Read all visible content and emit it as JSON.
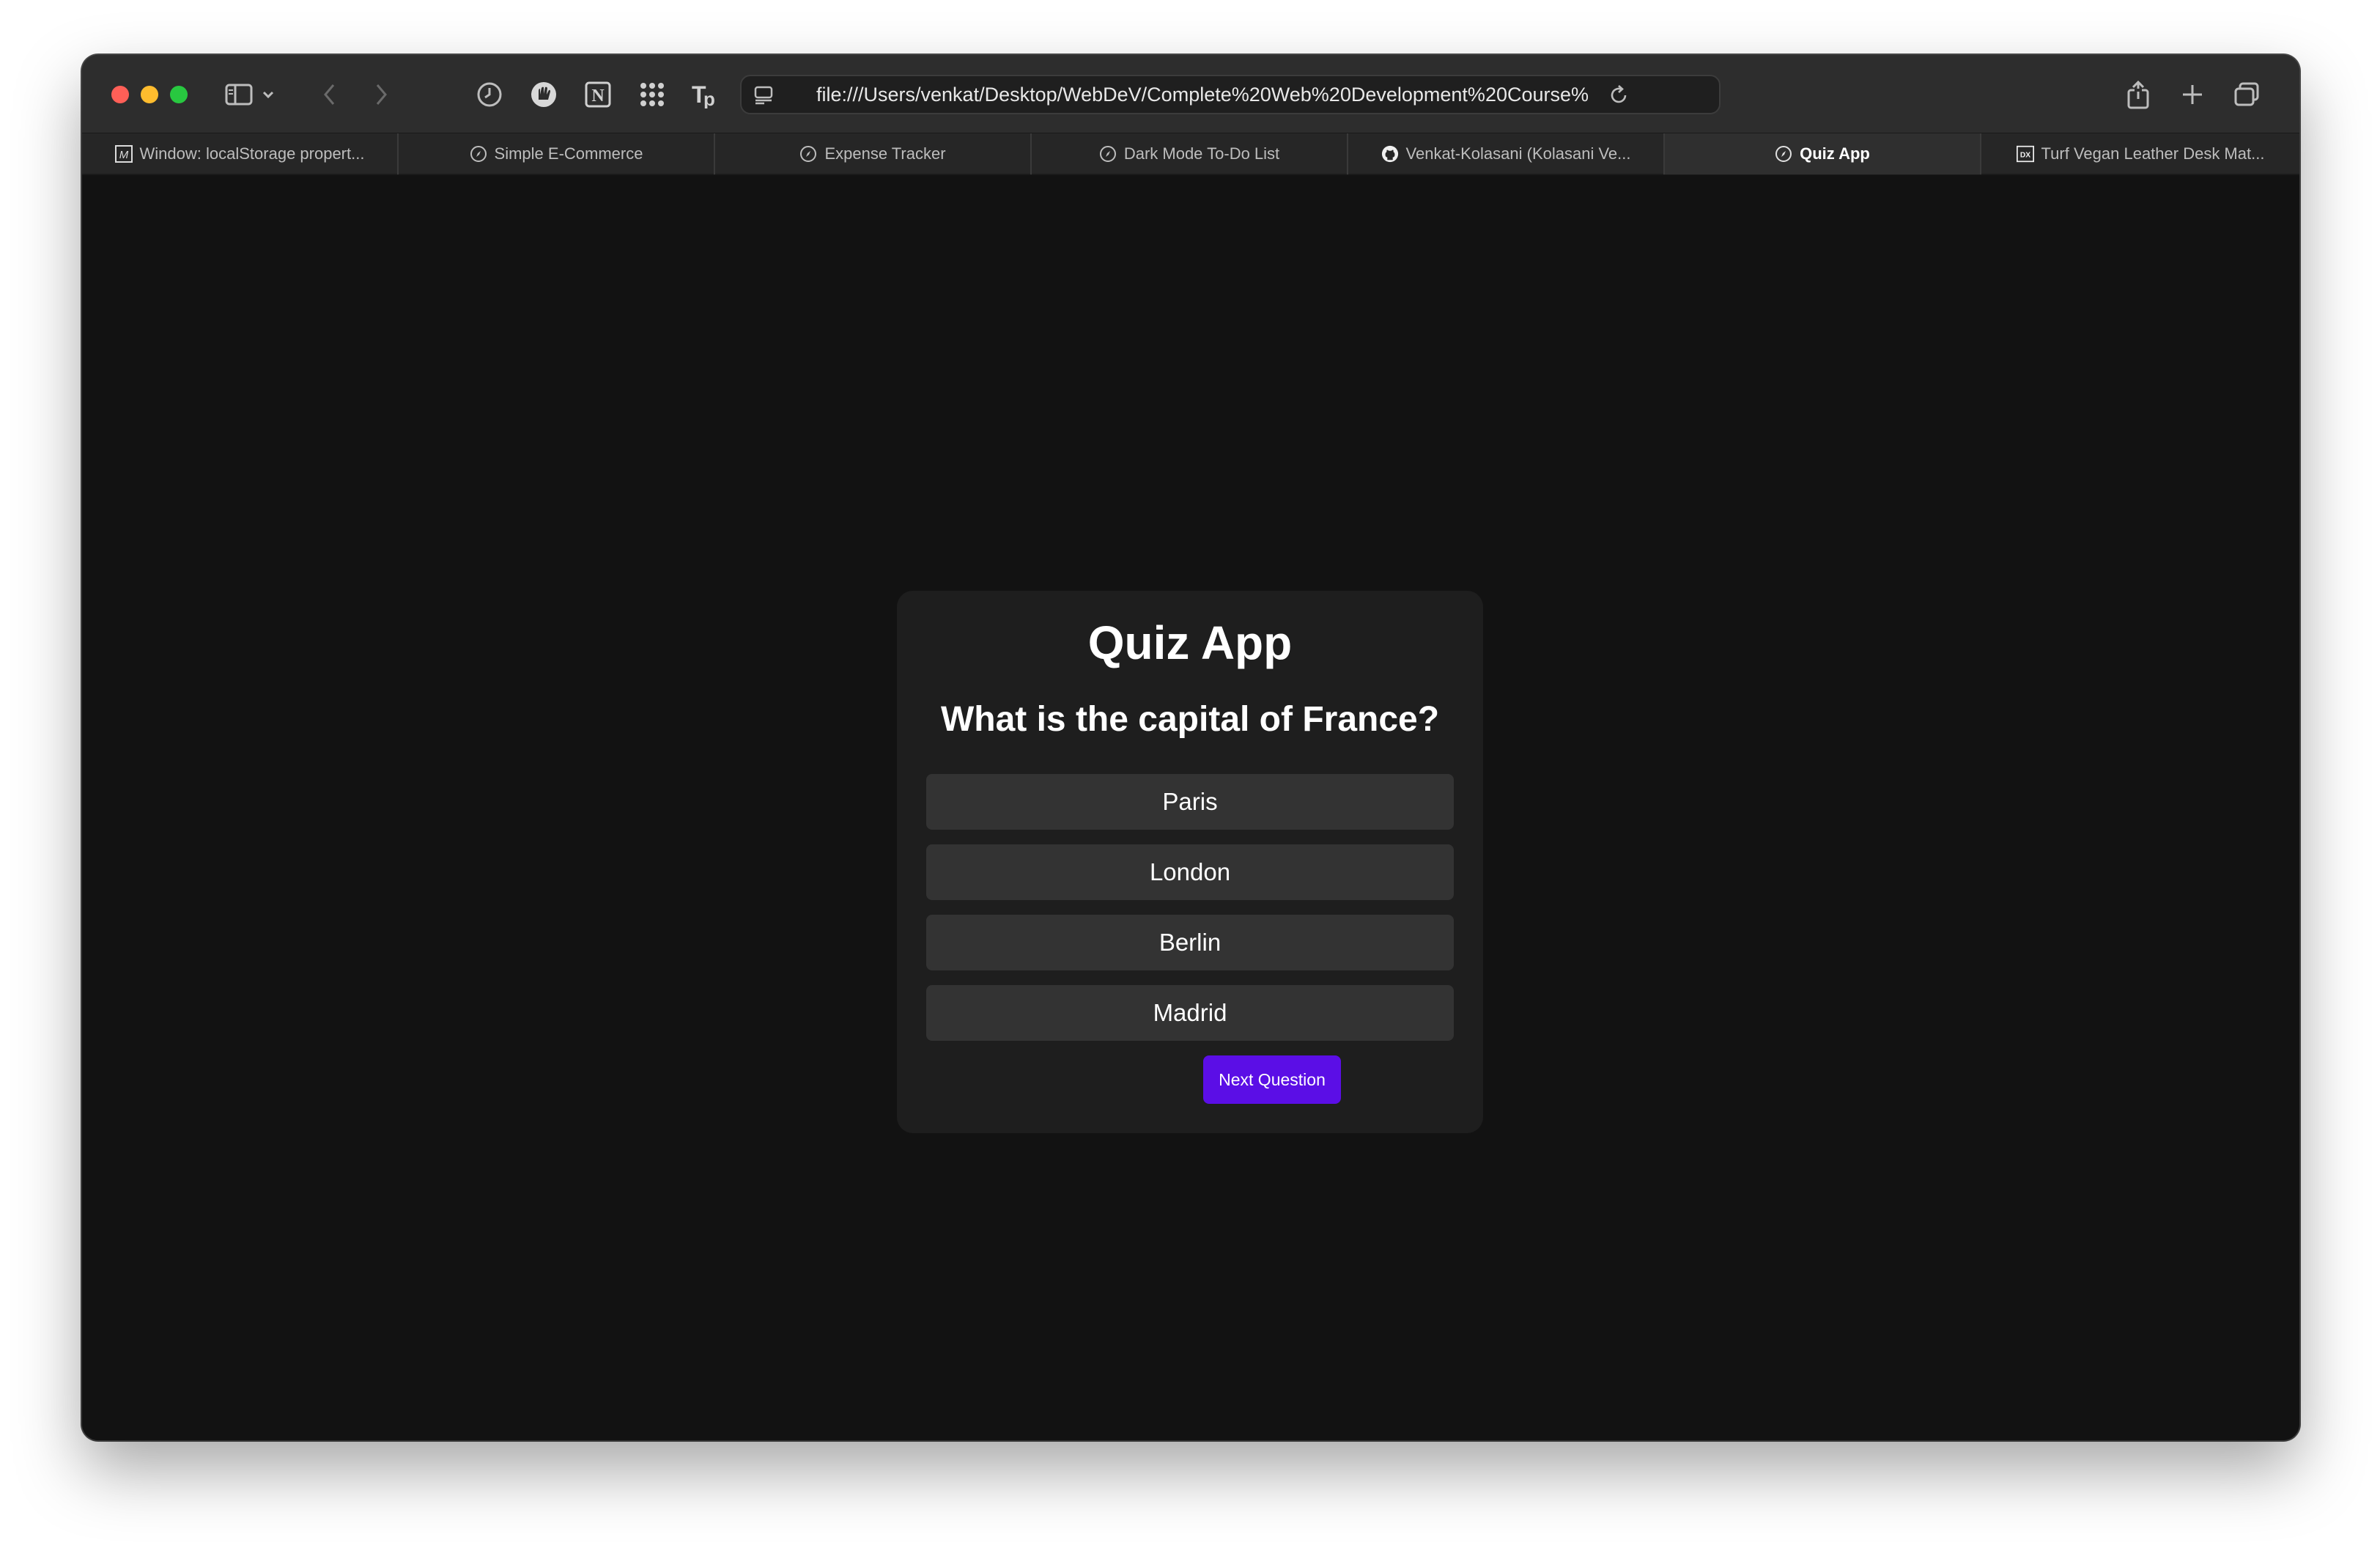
{
  "browser": {
    "address_url": "file:///Users/venkat/Desktop/WebDeV/Complete%20Web%20Development%20Course%",
    "tabs": [
      {
        "label": "Window: localStorage propert...",
        "icon": "mdn-icon"
      },
      {
        "label": "Simple E-Commerce",
        "icon": "compass-icon"
      },
      {
        "label": "Expense Tracker",
        "icon": "compass-icon"
      },
      {
        "label": "Dark Mode To-Do List",
        "icon": "compass-icon"
      },
      {
        "label": "Venkat-Kolasani (Kolasani Ve...",
        "icon": "github-icon"
      },
      {
        "label": "Quiz App",
        "icon": "compass-icon",
        "active": true
      },
      {
        "label": "Turf Vegan Leather Desk Mat...",
        "icon": "dx-icon"
      }
    ]
  },
  "quiz": {
    "title": "Quiz App",
    "question": "What is the capital of France?",
    "answers": [
      "Paris",
      "London",
      "Berlin",
      "Madrid"
    ],
    "next_label": "Next Question",
    "accent_color": "#5b0ee6"
  }
}
